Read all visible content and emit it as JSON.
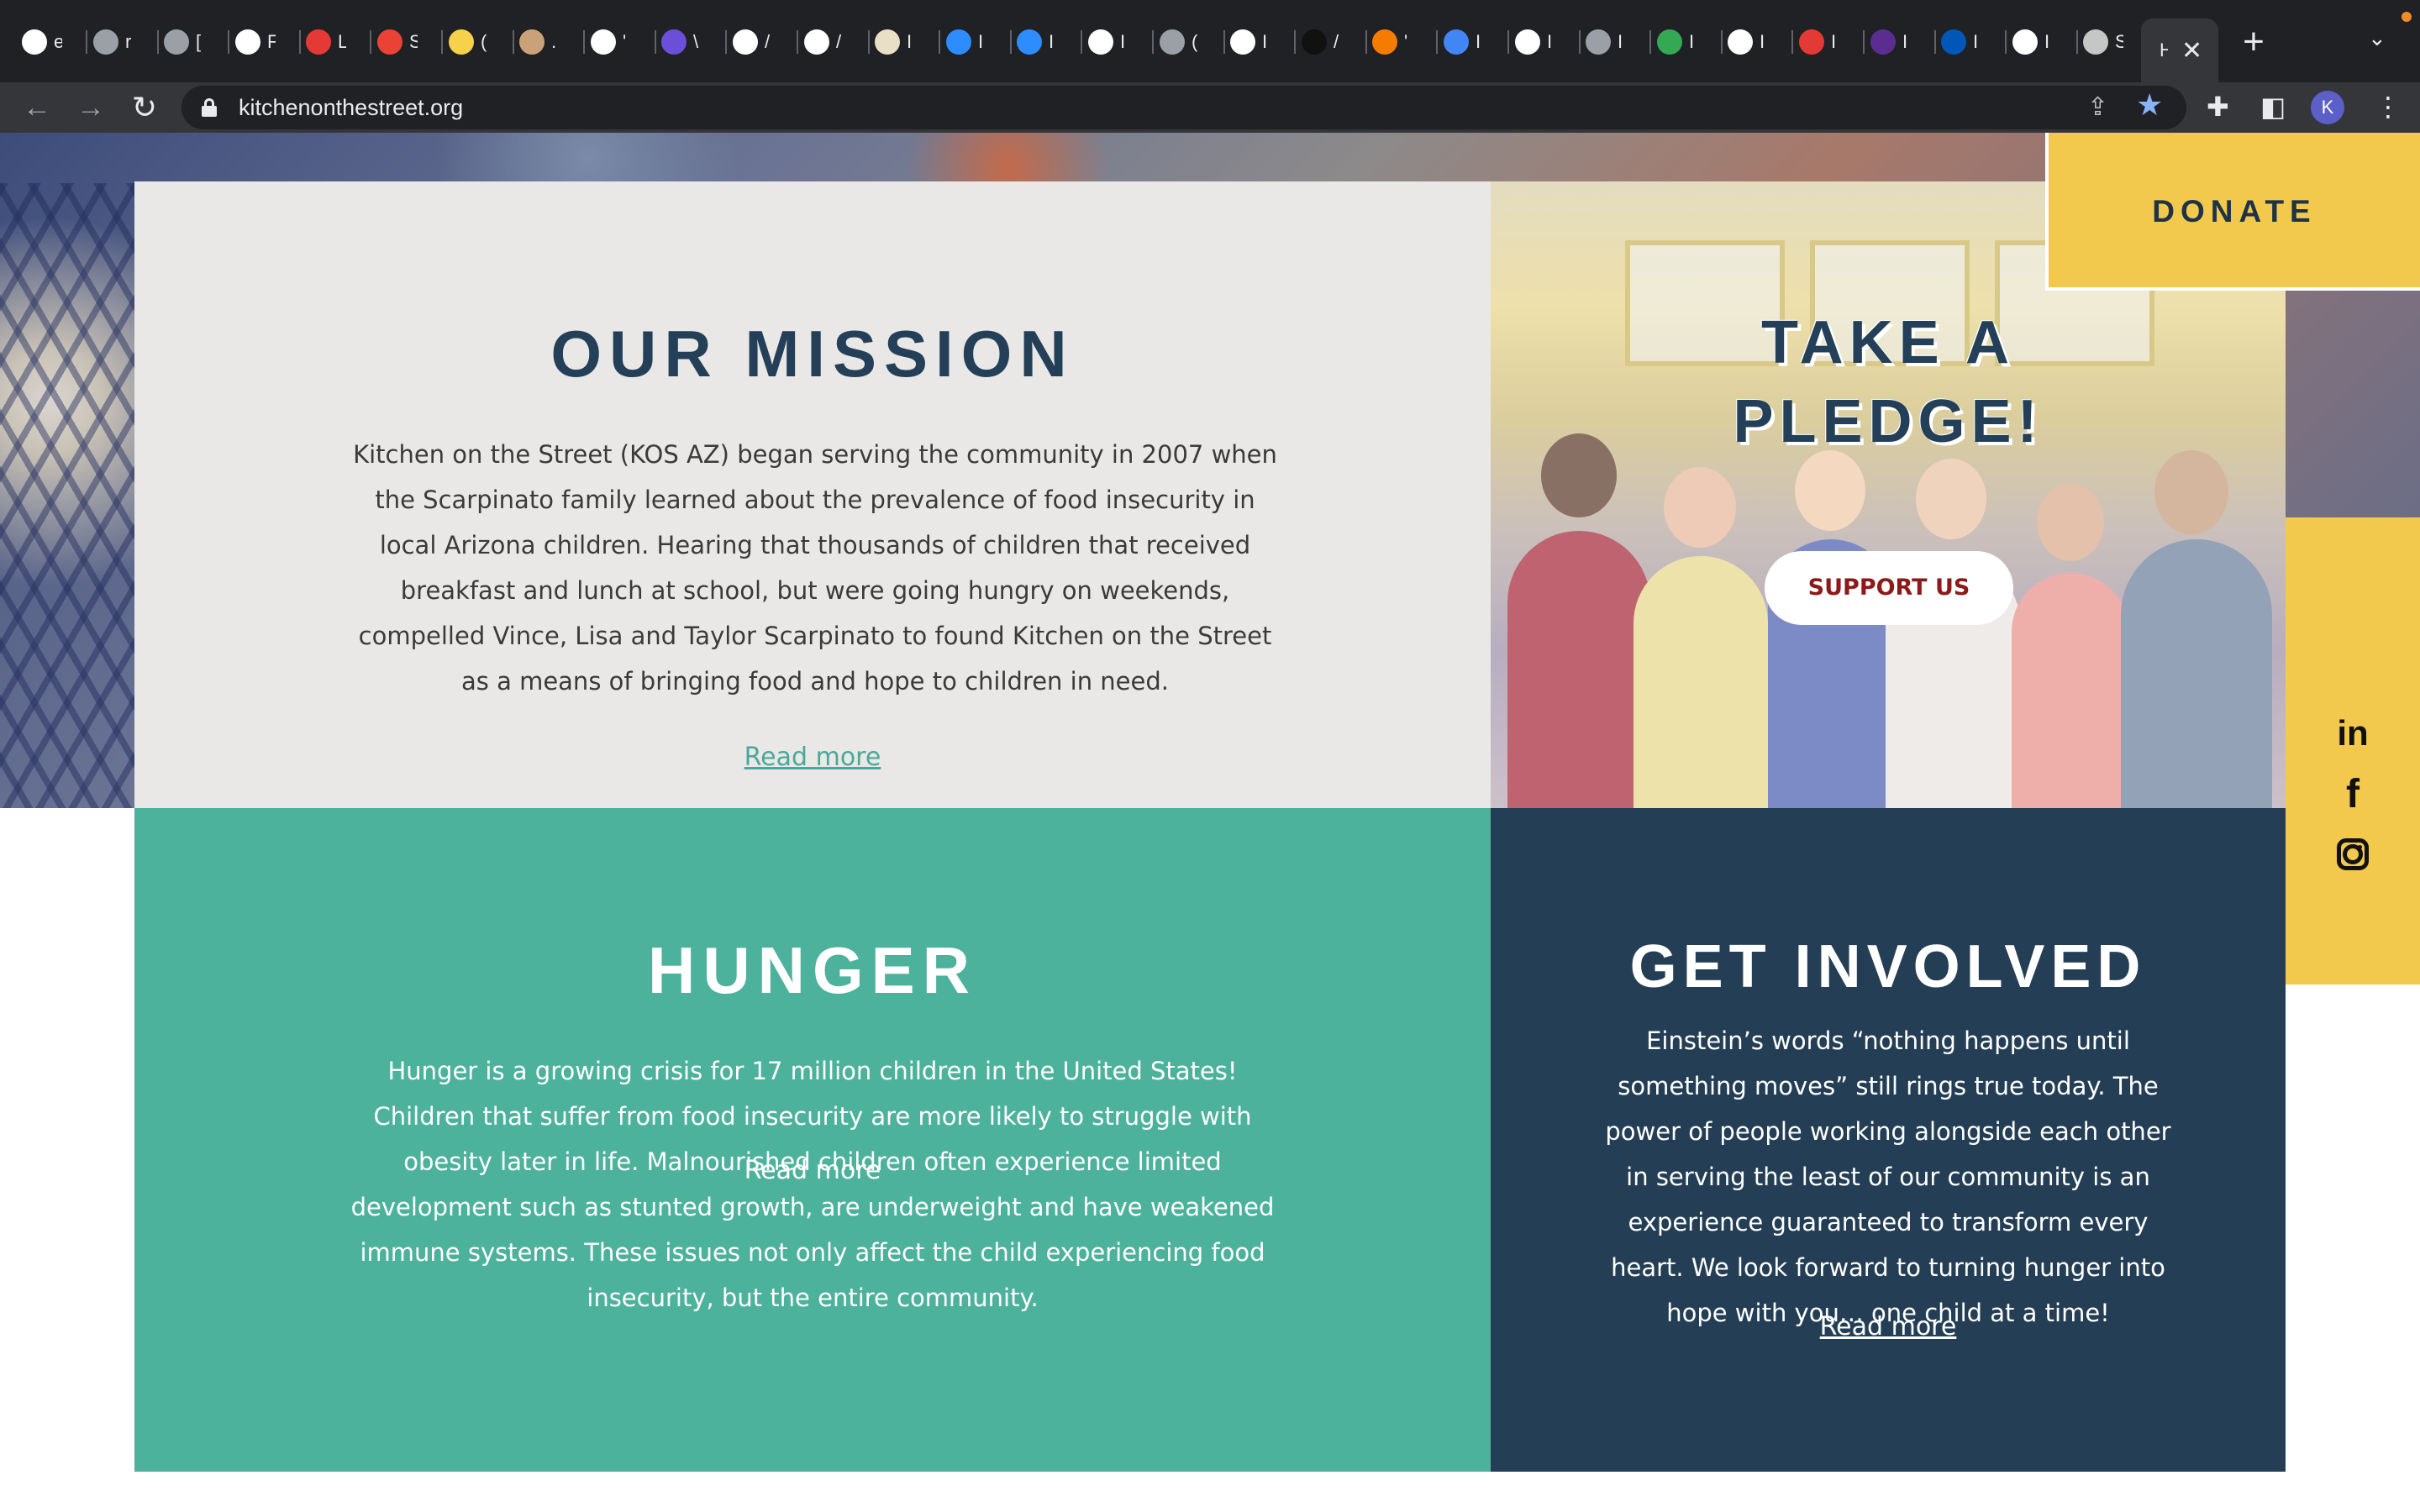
{
  "browser": {
    "tabs": [
      {
        "icon": "chrome-icon",
        "letter": "e",
        "color": "#ffffff"
      },
      {
        "icon": "globe-icon",
        "letter": "r",
        "color": "#9aa0a6"
      },
      {
        "icon": "globe-icon",
        "letter": "[",
        "color": "#9aa0a6"
      },
      {
        "icon": "github-icon",
        "letter": "F",
        "color": "#ffffff"
      },
      {
        "icon": "asterisk-icon",
        "letter": "L",
        "color": "#e53935"
      },
      {
        "icon": "gmail-icon",
        "letter": "S",
        "color": "#ea4335"
      },
      {
        "icon": "miro-icon",
        "letter": "(",
        "color": "#f7d14a"
      },
      {
        "icon": "dog-icon",
        "letter": ".",
        "color": "#c9a27a"
      },
      {
        "icon": "google-icon",
        "letter": "'",
        "color": "#ffffff"
      },
      {
        "icon": "list-icon",
        "letter": "\\",
        "color": "#6b4fd8"
      },
      {
        "icon": "amazon-icon",
        "letter": "/",
        "color": "#ffffff"
      },
      {
        "icon": "amazon-icon",
        "letter": "/",
        "color": "#ffffff"
      },
      {
        "icon": "goodreads-icon",
        "letter": "I",
        "color": "#e9dfc7"
      },
      {
        "icon": "zoom-icon",
        "letter": "I",
        "color": "#2d8cff"
      },
      {
        "icon": "zoom-icon",
        "letter": "I",
        "color": "#2d8cff"
      },
      {
        "icon": "github-icon",
        "letter": "I",
        "color": "#ffffff"
      },
      {
        "icon": "globe-icon",
        "letter": "(",
        "color": "#9aa0a6"
      },
      {
        "icon": "chrome-icon",
        "letter": "I",
        "color": "#ffffff"
      },
      {
        "icon": "amazon-icon",
        "letter": "/",
        "color": "#111111"
      },
      {
        "icon": "flower-icon",
        "letter": "'",
        "color": "#f57c00"
      },
      {
        "icon": "docs-icon",
        "letter": "I",
        "color": "#4285f4"
      },
      {
        "icon": "chrome-icon",
        "letter": "I",
        "color": "#ffffff"
      },
      {
        "icon": "globe-icon",
        "letter": "I",
        "color": "#9aa0a6"
      },
      {
        "icon": "apple-icon",
        "letter": "I",
        "color": "#34a853"
      },
      {
        "icon": "frac-icon",
        "letter": "I",
        "color": "#ffffff"
      },
      {
        "icon": "circle-icon",
        "letter": "I",
        "color": "#e53935"
      },
      {
        "icon": "pin-icon",
        "letter": "I",
        "color": "#5c2d91"
      },
      {
        "icon": "cdc-icon",
        "letter": "I",
        "color": "#0057b8"
      },
      {
        "icon": "library-icon",
        "letter": "I",
        "color": "#ffffff"
      },
      {
        "icon": "wordpress-icon",
        "letter": "S",
        "color": "#c4c7c5"
      }
    ],
    "active_tab_letter": "H",
    "url": "kitchenonthestreet.org",
    "profile_initial": "K"
  },
  "page": {
    "donate_label": "DONATE",
    "mission": {
      "title": "OUR MISSION",
      "body": "Kitchen on the Street (KOS AZ) began serving the community in 2007 when the Scarpinato family learned about the prevalence of food insecurity in local Arizona children. Hearing that thousands of children that received breakfast and lunch at school, but were going hungry on weekends, compelled Vince, Lisa and Taylor Scarpinato to found Kitchen on the Street as a means of bringing food and hope to children in need.",
      "read_more": "Read more"
    },
    "pledge": {
      "title": "TAKE A PLEDGE!",
      "button": "SUPPORT US"
    },
    "hunger": {
      "title": "HUNGER",
      "body": "Hunger is a growing crisis for 17 million children in the United States!  Children that suffer from food insecurity are more likely to struggle with obesity later in life. Malnourished children often experience limited development such as stunted growth, are underweight and have weakened immune systems. These issues not only affect the child experiencing food insecurity, but the entire community.",
      "read_more": "Read more"
    },
    "involved": {
      "title": "GET INVOLVED",
      "body": "Einstein’s words “nothing happens until something moves” still rings true today.  The power of people working alongside each other in serving the least of our community is an experience guaranteed to transform every heart.  We look forward to turning hunger into hope with you… one child at a time!",
      "read_more": "Read more"
    },
    "social": [
      "linkedin-icon",
      "facebook-icon",
      "instagram-icon"
    ],
    "colors": {
      "navy": "#243f58",
      "teal": "#4db29c",
      "yellow": "#f2c94c",
      "support_red": "#8c1a1a"
    }
  }
}
